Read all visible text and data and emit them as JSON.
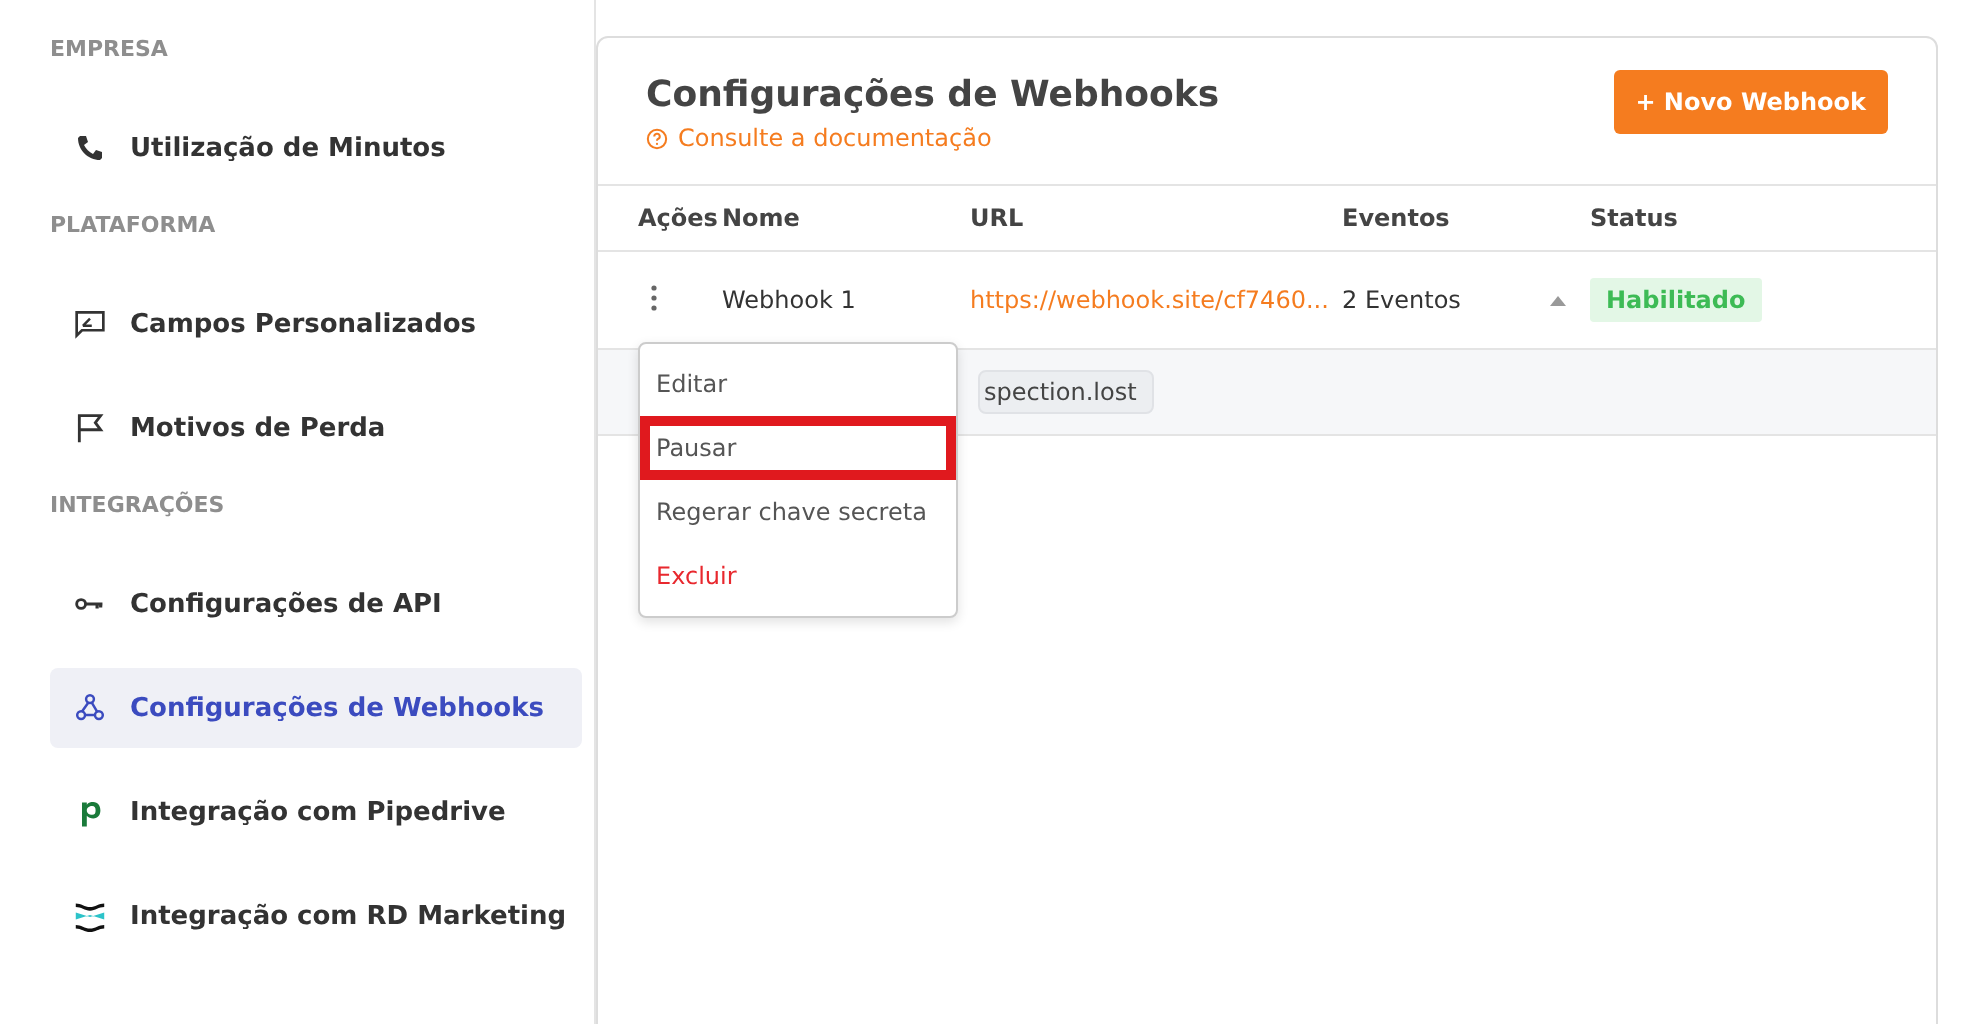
{
  "sidebar": {
    "sections": [
      {
        "heading": "EMPRESA",
        "items": [
          {
            "label": "Utilização de Minutos",
            "kind": "phone",
            "selected": false
          }
        ]
      },
      {
        "heading": "PLATAFORMA",
        "items": [
          {
            "label": "Campos Personalizados",
            "kind": "form",
            "selected": false
          },
          {
            "label": "Motivos de Perda",
            "kind": "flag",
            "selected": false
          }
        ]
      },
      {
        "heading": "INTEGRAÇÕES",
        "items": [
          {
            "label": "Configurações de API",
            "kind": "key",
            "selected": false
          },
          {
            "label": "Configurações de Webhooks",
            "kind": "webhook",
            "selected": true
          },
          {
            "label": "Integração com Pipedrive",
            "kind": "pipedrive",
            "selected": false
          },
          {
            "label": "Integração com RD Marketing",
            "kind": "rd",
            "selected": false
          }
        ]
      }
    ]
  },
  "panel": {
    "title": "Configurações de Webhooks",
    "docs_link": "Consulte a documentação",
    "new_button": "+ Novo Webhook",
    "table": {
      "columns": [
        "Ações",
        "Nome",
        "URL",
        "Eventos",
        "Status"
      ],
      "rows": [
        {
          "name": "Webhook 1",
          "url": "https://webhook.site/cf7460...",
          "events": "2 Eventos",
          "expanded": true,
          "status": "Habilitado",
          "event_tags": [
            "spection.lost"
          ]
        }
      ]
    }
  },
  "action_menu": {
    "items": [
      {
        "label": "Editar",
        "kind": "normal",
        "highlighted": false
      },
      {
        "label": "Pausar",
        "kind": "normal",
        "highlighted": true
      },
      {
        "label": "Regerar chave secreta",
        "kind": "normal",
        "highlighted": false
      },
      {
        "label": "Excluir",
        "kind": "danger",
        "highlighted": false
      }
    ]
  }
}
